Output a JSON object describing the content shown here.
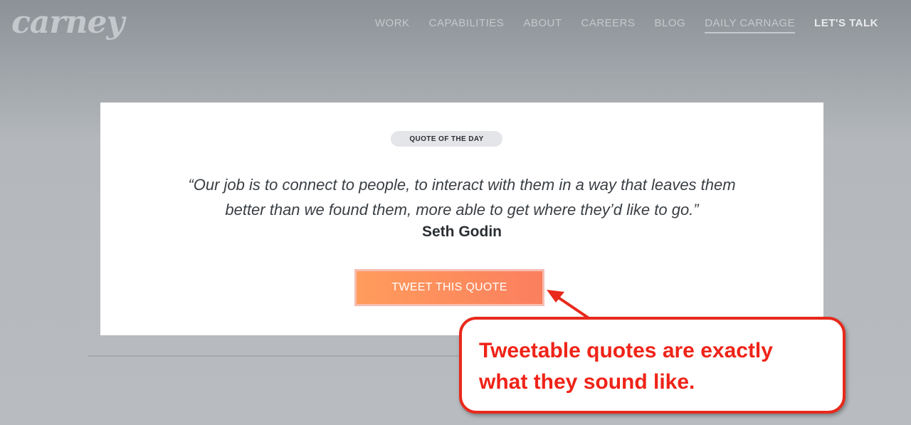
{
  "header": {
    "logo": "carney",
    "nav": [
      {
        "label": "WORK"
      },
      {
        "label": "CAPABILITIES"
      },
      {
        "label": "ABOUT"
      },
      {
        "label": "CAREERS"
      },
      {
        "label": "BLOG"
      },
      {
        "label": "DAILY CARNAGE"
      },
      {
        "label": "LET'S TALK"
      }
    ]
  },
  "card": {
    "badge": "QUOTE OF THE DAY",
    "quote_line1": "“Our job is to connect to people, to interact with them in a way that leaves them",
    "quote_line2": "better than we found them, more able to get where they’d like to go.”",
    "author": "Seth Godin",
    "button_label": "TWEET THIS QUOTE"
  },
  "annotation": {
    "line1": "Tweetable quotes are exactly",
    "line2": "what they sound like.",
    "color": "#ef2318"
  }
}
